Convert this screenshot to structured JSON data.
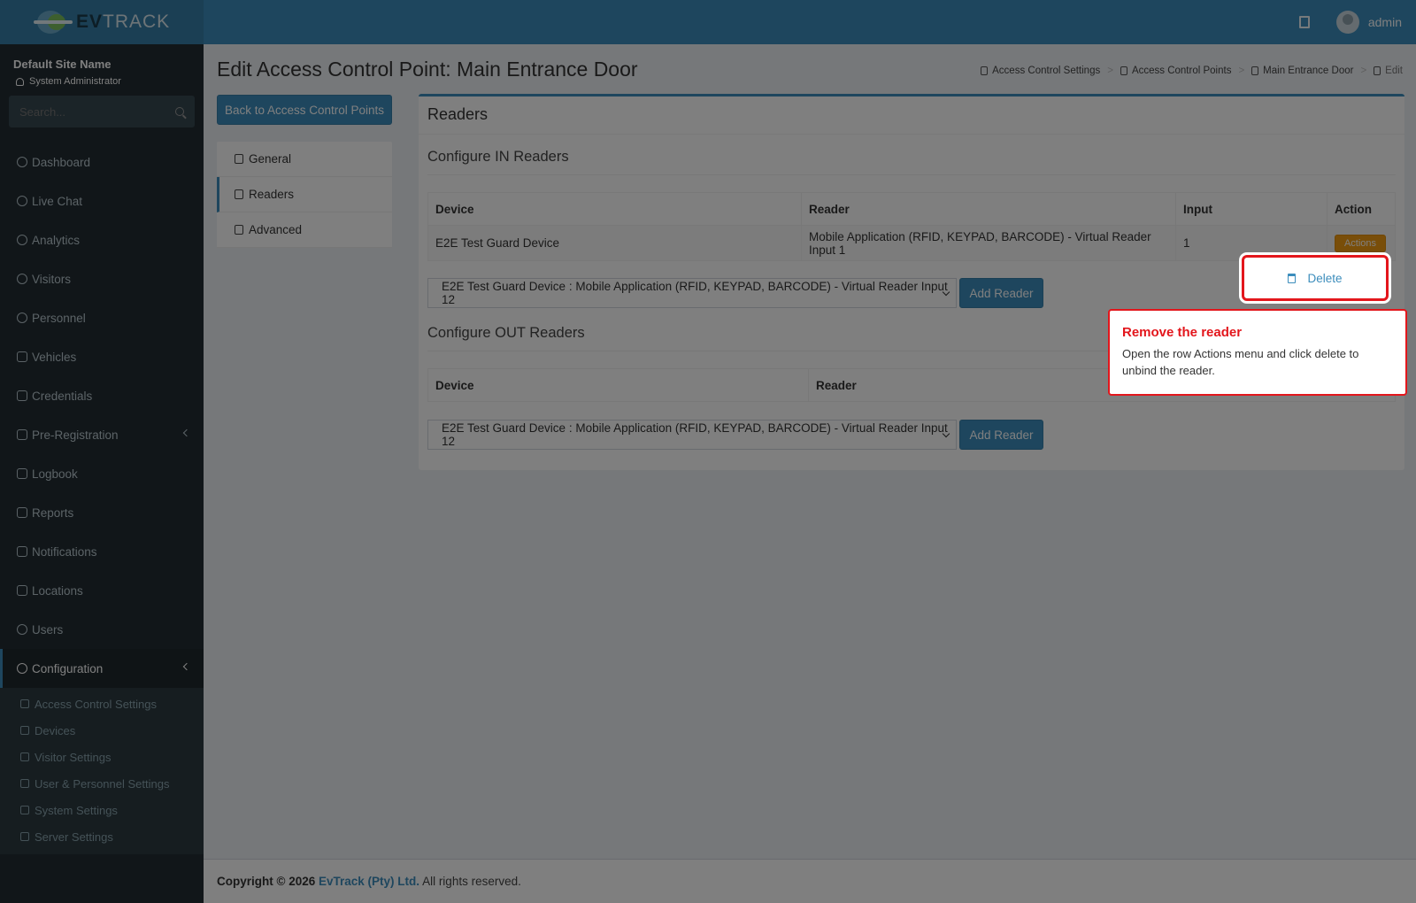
{
  "brand": {
    "name_bold": "EV",
    "name_light": "TRACK"
  },
  "header": {
    "user": "admin"
  },
  "sidebar": {
    "site_name": "Default Site Name",
    "role": "System Administrator",
    "search_placeholder": "Search...",
    "items": [
      {
        "label": "Dashboard",
        "icon": "dashboard-icon"
      },
      {
        "label": "Live Chat",
        "icon": "headset-icon"
      },
      {
        "label": "Analytics",
        "icon": "analytics-icon"
      },
      {
        "label": "Visitors",
        "icon": "eye-icon"
      },
      {
        "label": "Personnel",
        "icon": "personnel-icon"
      },
      {
        "label": "Vehicles",
        "icon": "car-icon"
      },
      {
        "label": "Credentials",
        "icon": "id-card-icon"
      },
      {
        "label": "Pre-Registration",
        "icon": "arrows-icon"
      },
      {
        "label": "Logbook",
        "icon": "book-icon"
      },
      {
        "label": "Reports",
        "icon": "chart-icon"
      },
      {
        "label": "Notifications",
        "icon": "chat-icon"
      },
      {
        "label": "Locations",
        "icon": "map-icon"
      },
      {
        "label": "Users",
        "icon": "users-icon"
      },
      {
        "label": "Configuration",
        "icon": "gear-icon"
      }
    ],
    "config_sub": [
      {
        "label": "Access Control Settings",
        "icon": "lock-icon"
      },
      {
        "label": "Devices",
        "icon": "devices-icon"
      },
      {
        "label": "Visitor Settings",
        "icon": "eye-icon"
      },
      {
        "label": "User & Personnel Settings",
        "icon": "users-icon"
      },
      {
        "label": "System Settings",
        "icon": "sliders-icon"
      },
      {
        "label": "Server Settings",
        "icon": "wrench-icon"
      }
    ]
  },
  "page": {
    "title": "Edit Access Control Point: Main Entrance Door",
    "breadcrumb": [
      "Access Control Settings",
      "Access Control Points",
      "Main Entrance Door",
      "Edit"
    ],
    "back_label": "Back to Access Control Points",
    "tabs": [
      "General",
      "Readers",
      "Advanced"
    ]
  },
  "readers": {
    "box_title": "Readers",
    "in_title": "Configure IN Readers",
    "out_title": "Configure OUT Readers",
    "in_headers": [
      "Device",
      "Reader",
      "Input",
      "Action"
    ],
    "out_headers": [
      "Device",
      "Reader"
    ],
    "in_rows": [
      {
        "device": "E2E Test Guard Device",
        "reader": "Mobile Application (RFID, KEYPAD, BARCODE) - Virtual Reader Input 1",
        "input": "1",
        "action": "Actions"
      }
    ],
    "select_value": "E2E Test Guard Device : Mobile Application (RFID, KEYPAD, BARCODE) - Virtual Reader Input 12",
    "add_label": "Add Reader"
  },
  "popup": {
    "delete_label": "Delete"
  },
  "tooltip": {
    "title": "Remove the reader",
    "body": "Open the row Actions menu and click delete to unbind the reader."
  },
  "footer": {
    "copyright": "Copyright © 2026",
    "company": "EvTrack (Pty) Ltd.",
    "rights": "All rights reserved."
  },
  "colors": {
    "accent": "#3c8dbc",
    "sidebar": "#222d32",
    "warning": "#f39c12",
    "highlight": "#e3161c"
  }
}
